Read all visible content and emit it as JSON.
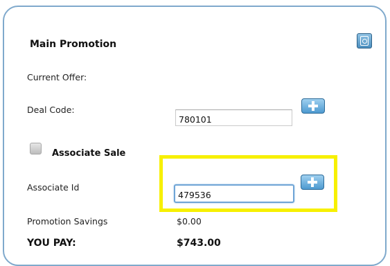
{
  "promotion": {
    "title": "Main Promotion",
    "current_offer_label": "Current Offer:",
    "deal_code_label": "Deal Code:",
    "deal_code_value": "780101",
    "associate_sale_label": "Associate Sale",
    "associate_sale_checked": false,
    "associate_id_label": "Associate Id",
    "associate_id_value": "479536",
    "promotion_savings_label": "Promotion Savings",
    "promotion_savings_value": "$0.00",
    "you_pay_label": "YOU PAY:",
    "you_pay_value": "$743.00"
  },
  "icons": {
    "corner_button": "coupon-icon",
    "deal_code_add": "plus-icon",
    "associate_id_add": "plus-icon"
  },
  "colors": {
    "panel_border": "#7fa9cc",
    "button_blue": "#4e9ad0",
    "highlight": "#f7f000"
  }
}
